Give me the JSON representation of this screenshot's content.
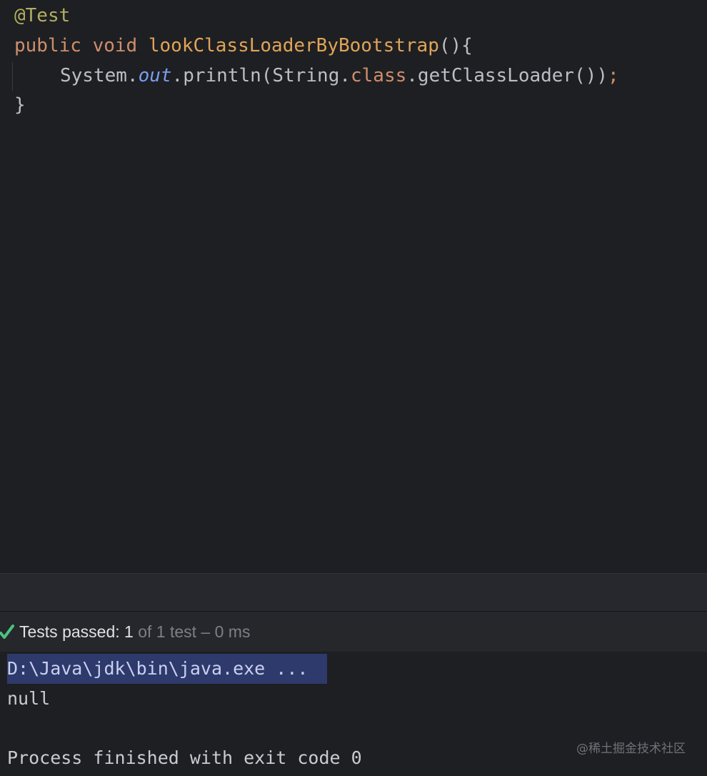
{
  "editor": {
    "annotation": "@Test",
    "signature": {
      "keyword_public": "public",
      "keyword_void": "void",
      "method_name": "lookClassLoaderByBootstrap",
      "params_brace": "(){"
    },
    "statement": {
      "system": "System.",
      "out": "out",
      "println_open": ".println(String.",
      "class_kw": "class",
      "get_loader": ".getClassLoader())",
      "semicolon": ";"
    },
    "closing_brace": "}"
  },
  "test_status": {
    "label": "Tests passed: ",
    "count": "1",
    "detail": " of 1 test – 0 ms",
    "status_color": "#4cc281"
  },
  "console": {
    "command_line": "D:\\Java\\jdk\\bin\\java.exe ...",
    "output_line": "null",
    "exit_message": "Process finished with exit code 0"
  },
  "watermark": "@稀土掘金技术社区",
  "colors": {
    "background": "#1e1f22",
    "keyword": "#cf8e6d",
    "method": "#e0a458",
    "annotation": "#b3ae60",
    "field": "#7a9ef0",
    "selection": "#2e3a6b"
  }
}
